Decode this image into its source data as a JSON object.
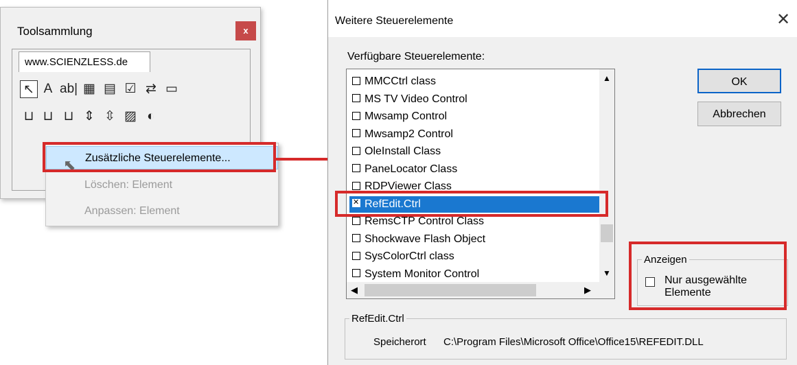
{
  "toolbox": {
    "title": "Toolsammlung",
    "close_glyph": "x",
    "tab_label": "www.SCIENZLESS.de",
    "tools": [
      {
        "name": "pointer-icon",
        "glyph": "↖"
      },
      {
        "name": "label-tool-icon",
        "glyph": "A"
      },
      {
        "name": "textbox-tool-icon",
        "glyph": "ab|"
      },
      {
        "name": "combobox-tool-icon",
        "glyph": "▦"
      },
      {
        "name": "listbox-tool-icon",
        "glyph": "▤"
      },
      {
        "name": "checkbox-tool-icon",
        "glyph": "☑"
      },
      {
        "name": "optionbutton-tool-icon",
        "glyph": "⇄"
      },
      {
        "name": "togglebutton-tool-icon",
        "glyph": "▭"
      },
      {
        "name": "frame-tool-icon",
        "glyph": "⊔"
      },
      {
        "name": "commandbutton-tool-icon",
        "glyph": "⊔"
      },
      {
        "name": "tabstrip-tool-icon",
        "glyph": "⊔"
      },
      {
        "name": "multipage-tool-icon",
        "glyph": "⇕"
      },
      {
        "name": "scrollbar-tool-icon",
        "glyph": "⇳"
      },
      {
        "name": "image-tool-icon",
        "glyph": "▨"
      },
      {
        "name": "spinbutton-tool-icon",
        "glyph": "◐"
      }
    ]
  },
  "context_menu": {
    "items": [
      {
        "label": "Zusätzliche Steuerelemente...",
        "enabled": true
      },
      {
        "label": "Löschen: Element",
        "enabled": false
      },
      {
        "label": "Anpassen: Element",
        "enabled": false
      }
    ]
  },
  "dialog": {
    "title": "Weitere Steuerelemente",
    "close_glyph": "✕",
    "list_label": "Verfügbare Steuerelemente:",
    "controls": [
      {
        "label": "MMCCtrl class",
        "checked": false,
        "selected": false
      },
      {
        "label": "MS TV Video Control",
        "checked": false,
        "selected": false
      },
      {
        "label": "Mwsamp Control",
        "checked": false,
        "selected": false
      },
      {
        "label": "Mwsamp2 Control",
        "checked": false,
        "selected": false
      },
      {
        "label": "OleInstall Class",
        "checked": false,
        "selected": false
      },
      {
        "label": "PaneLocator Class",
        "checked": false,
        "selected": false
      },
      {
        "label": "RDPViewer Class",
        "checked": false,
        "selected": false
      },
      {
        "label": "RefEdit.Ctrl",
        "checked": true,
        "selected": true
      },
      {
        "label": "RemsCTP Control Class",
        "checked": false,
        "selected": false
      },
      {
        "label": "Shockwave Flash Object",
        "checked": false,
        "selected": false
      },
      {
        "label": "SysColorCtrl class",
        "checked": false,
        "selected": false
      },
      {
        "label": "System Monitor Control",
        "checked": false,
        "selected": false
      }
    ],
    "ok_label": "OK",
    "cancel_label": "Abbrechen",
    "show_group": {
      "legend": "Anzeigen",
      "checkbox_label_line1": "Nur ausgewählte",
      "checkbox_label_line2": "Elemente",
      "checked": false
    },
    "info_group": {
      "legend": "RefEdit.Ctrl",
      "location_label": "Speicherort",
      "location_value": "C:\\Program Files\\Microsoft Office\\Office15\\REFEDIT.DLL"
    }
  },
  "colors": {
    "highlight_red": "#d62a2a",
    "selection_blue": "#1a78d0"
  }
}
